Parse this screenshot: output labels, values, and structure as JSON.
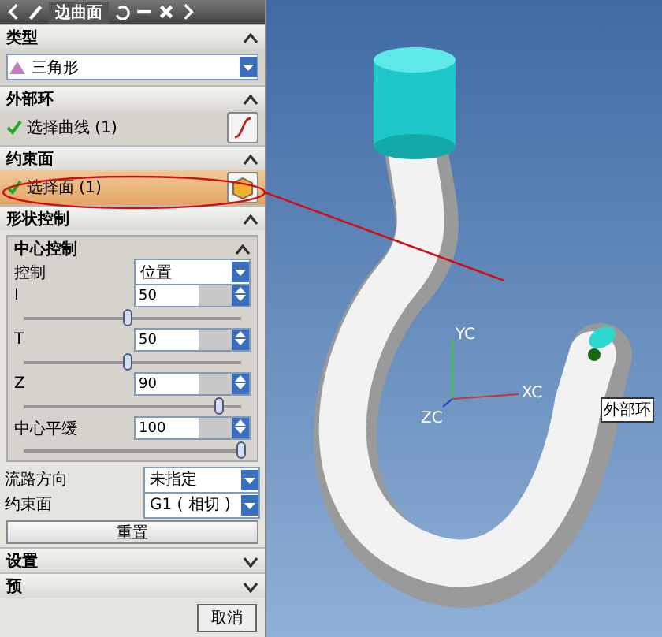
{
  "window": {
    "title": "边曲面"
  },
  "type_section": {
    "header": "类型",
    "expanded": true,
    "dropdown": "三角形"
  },
  "outer_loop": {
    "header": "外部环",
    "expanded": true,
    "item": "选择曲线 (1)"
  },
  "constraint_face": {
    "header": "约束面",
    "expanded": true,
    "item": "选择面 (1)"
  },
  "shape_control": {
    "header": "形状控制",
    "expanded": true,
    "center_control": {
      "header": "中心控制",
      "expanded": true,
      "control_label": "控制",
      "control_value": "位置",
      "sliders": [
        {
          "label": "I",
          "value": "50",
          "level": 0.48
        },
        {
          "label": "T",
          "value": "50",
          "level": 0.48
        },
        {
          "label": "Z",
          "value": "90",
          "level": 0.9
        },
        {
          "label": "中心平缓",
          "value": "100",
          "level": 1
        }
      ]
    },
    "flow_direction": {
      "label": "流路方向",
      "value": "未指定"
    },
    "constraint": {
      "label": "约束面",
      "value": "G1 ( 相切 )"
    },
    "reset_button": "重置"
  },
  "collapsed_sections": [
    {
      "header": "设置",
      "expanded": false
    },
    {
      "header": "预",
      "expanded": false
    }
  ],
  "buttons": [
    "取消"
  ],
  "viewport": {
    "axes": [
      "YC",
      "XC",
      "ZC"
    ],
    "callout": "外部环"
  }
}
